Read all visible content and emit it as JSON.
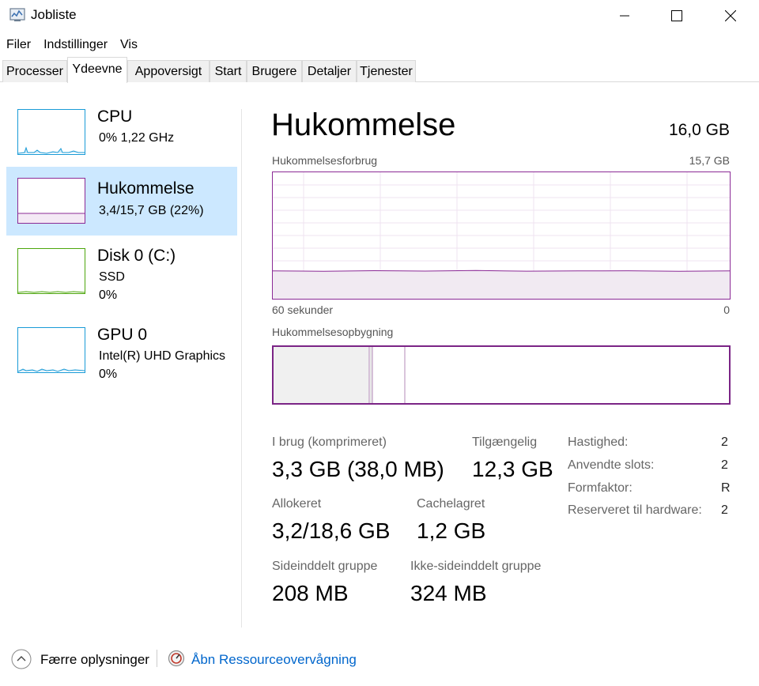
{
  "window": {
    "title": "Jobliste"
  },
  "menu": {
    "items": [
      "Filer",
      "Indstillinger",
      "Vis"
    ]
  },
  "tabs": [
    "Processer",
    "Ydeevne",
    "Appoversigt",
    "Start",
    "Brugere",
    "Detaljer",
    "Tjenester"
  ],
  "active_tab": "Ydeevne",
  "sidebar": {
    "items": [
      {
        "name": "CPU",
        "detail": "0%  1,22 GHz",
        "detail2": ""
      },
      {
        "name": "Hukommelse",
        "detail": "3,4/15,7 GB (22%)",
        "detail2": ""
      },
      {
        "name": "Disk 0 (C:)",
        "detail": "SSD",
        "detail2": "0%"
      },
      {
        "name": "GPU 0",
        "detail": "Intel(R) UHD Graphics",
        "detail2": "0%"
      }
    ],
    "selected": "Hukommelse"
  },
  "main": {
    "title": "Hukommelse",
    "total": "16,0 GB",
    "usage_chart": {
      "label": "Hukommelsesforbrug",
      "max_label": "15,7 GB",
      "x_left_label": "60 sekunder",
      "x_right_label": "0",
      "usage_fraction": 0.22
    },
    "composition_label": "Hukommelsesopbygning",
    "stats": {
      "in_use_label": "I brug (komprimeret)",
      "in_use_value": "3,3 GB (38,0 MB)",
      "available_label": "Tilgængelig",
      "available_value": "12,3 GB",
      "committed_label": "Allokeret",
      "committed_value": "3,2/18,6 GB",
      "cached_label": "Cachelagret",
      "cached_value": "1,2 GB",
      "paged_label": "Sideinddelt gruppe",
      "paged_value": "208 MB",
      "nonpaged_label": "Ikke-sideinddelt gruppe",
      "nonpaged_value": "324 MB"
    },
    "properties": [
      {
        "label": "Hastighed:",
        "value": "2"
      },
      {
        "label": "Anvendte slots:",
        "value": "2"
      },
      {
        "label": "Formfaktor:",
        "value": "R"
      },
      {
        "label": "Reserveret til hardware:",
        "value": "2"
      }
    ]
  },
  "footer": {
    "fewer_details": "Færre oplysninger",
    "resource_monitor": "Åbn Ressourceovervågning"
  },
  "colors": {
    "cpu": "#1a9bd7",
    "memory": "#8b2a96",
    "disk": "#4da60c",
    "gpu": "#1a9bd7",
    "selected_bg": "#cce8ff",
    "link": "#0066cc"
  }
}
